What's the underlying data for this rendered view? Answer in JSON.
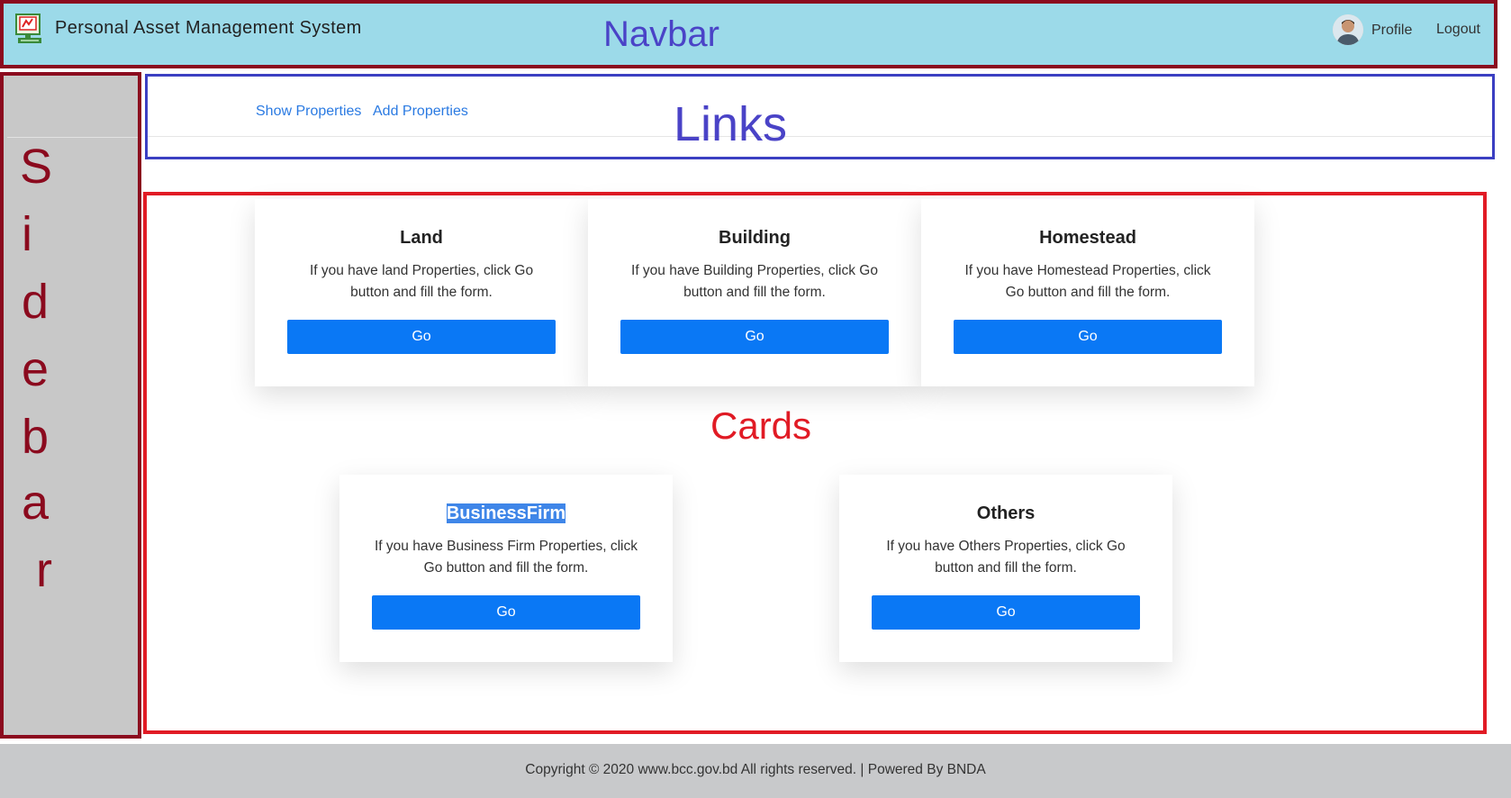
{
  "navbar": {
    "title": "Personal Asset Management System",
    "annotation": "Navbar",
    "profile_label": "Profile",
    "logout_label": "Logout"
  },
  "sidebar": {
    "annotation_letters": [
      "S",
      "i",
      "d",
      "e",
      "b",
      "a",
      "r"
    ]
  },
  "links": {
    "annotation": "Links",
    "items": [
      {
        "label": "Show Properties"
      },
      {
        "label": "Add Properties"
      }
    ]
  },
  "cards": {
    "annotation": "Cards",
    "items": [
      {
        "title": "Land",
        "text": "If you have land Properties, click Go button and fill the form.",
        "button": "Go"
      },
      {
        "title": "Building",
        "text": "If you have Building Properties, click Go button and fill the form.",
        "button": "Go"
      },
      {
        "title": "Homestead",
        "text": "If you have Homestead Properties, click Go button and fill the form.",
        "button": "Go"
      },
      {
        "title": "BusinessFirm",
        "text": "If you have Business Firm Properties, click Go button and fill the form.",
        "button": "Go"
      },
      {
        "title": "Others",
        "text": "If you have Others Properties, click Go button and fill the form.",
        "button": "Go"
      }
    ]
  },
  "footer": {
    "text": "Copyright © 2020 www.bcc.gov.bd All rights reserved. | Powered By BNDA"
  },
  "colors": {
    "navbar_bg": "#9cdae9",
    "sidebar_bg": "#c8c8c8",
    "button_blue": "#0a78f5",
    "link_blue": "#2a7ae2",
    "annotation_dark_red": "#8b0a1e",
    "annotation_red": "#e11b25",
    "annotation_blue": "#4a43c7"
  }
}
